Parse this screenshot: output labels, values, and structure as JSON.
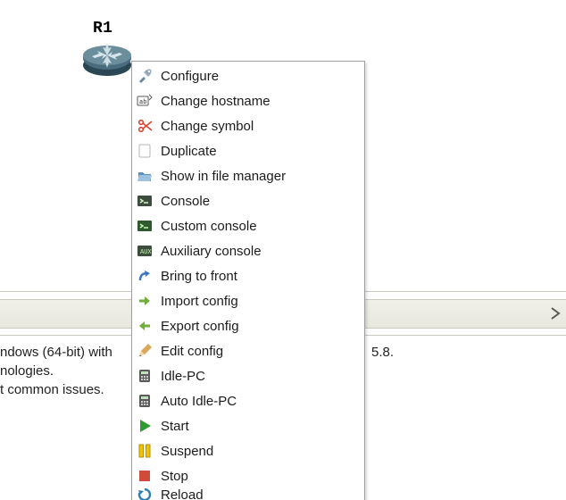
{
  "device": {
    "label": "R1"
  },
  "menu": {
    "items": [
      {
        "icon": "wrench-screwdriver-icon",
        "label": "Configure"
      },
      {
        "icon": "hostname-tag-icon",
        "label": "Change hostname"
      },
      {
        "icon": "scissors-icon",
        "label": "Change symbol"
      },
      {
        "icon": "blank-page-icon",
        "label": "Duplicate"
      },
      {
        "icon": "folder-open-icon",
        "label": "Show in file manager"
      },
      {
        "icon": "terminal-dark-icon",
        "label": "Console"
      },
      {
        "icon": "terminal-green-icon",
        "label": "Custom console"
      },
      {
        "icon": "terminal-aux-icon",
        "label": "Auxiliary console"
      },
      {
        "icon": "arrow-up-curved-icon",
        "label": "Bring to front"
      },
      {
        "icon": "arrow-import-icon",
        "label": "Import config"
      },
      {
        "icon": "arrow-export-icon",
        "label": "Export config"
      },
      {
        "icon": "pencil-icon",
        "label": "Edit config"
      },
      {
        "icon": "calculator-icon",
        "label": "Idle-PC"
      },
      {
        "icon": "calculator-icon",
        "label": "Auto Idle-PC"
      },
      {
        "icon": "play-icon",
        "label": "Start"
      },
      {
        "icon": "pause-icon",
        "label": "Suspend"
      },
      {
        "icon": "stop-icon",
        "label": "Stop"
      },
      {
        "icon": "reload-icon",
        "label": "Reload"
      }
    ]
  },
  "log": {
    "line1_left": "ndows (64-bit) with",
    "line1_right": "5.8.",
    "line2": "nologies.",
    "line3": "t common issues."
  },
  "colors": {
    "router_body": "#4a6c7c",
    "start_green": "#2e9b2e",
    "pause_yellow": "#f2c200",
    "stop_red": "#d24a3a",
    "terminal_dark": "#3d4d3d",
    "folder_blue": "#5a8fc2",
    "scissors_red": "#d7452f",
    "arrow_blue": "#3b78c4"
  }
}
